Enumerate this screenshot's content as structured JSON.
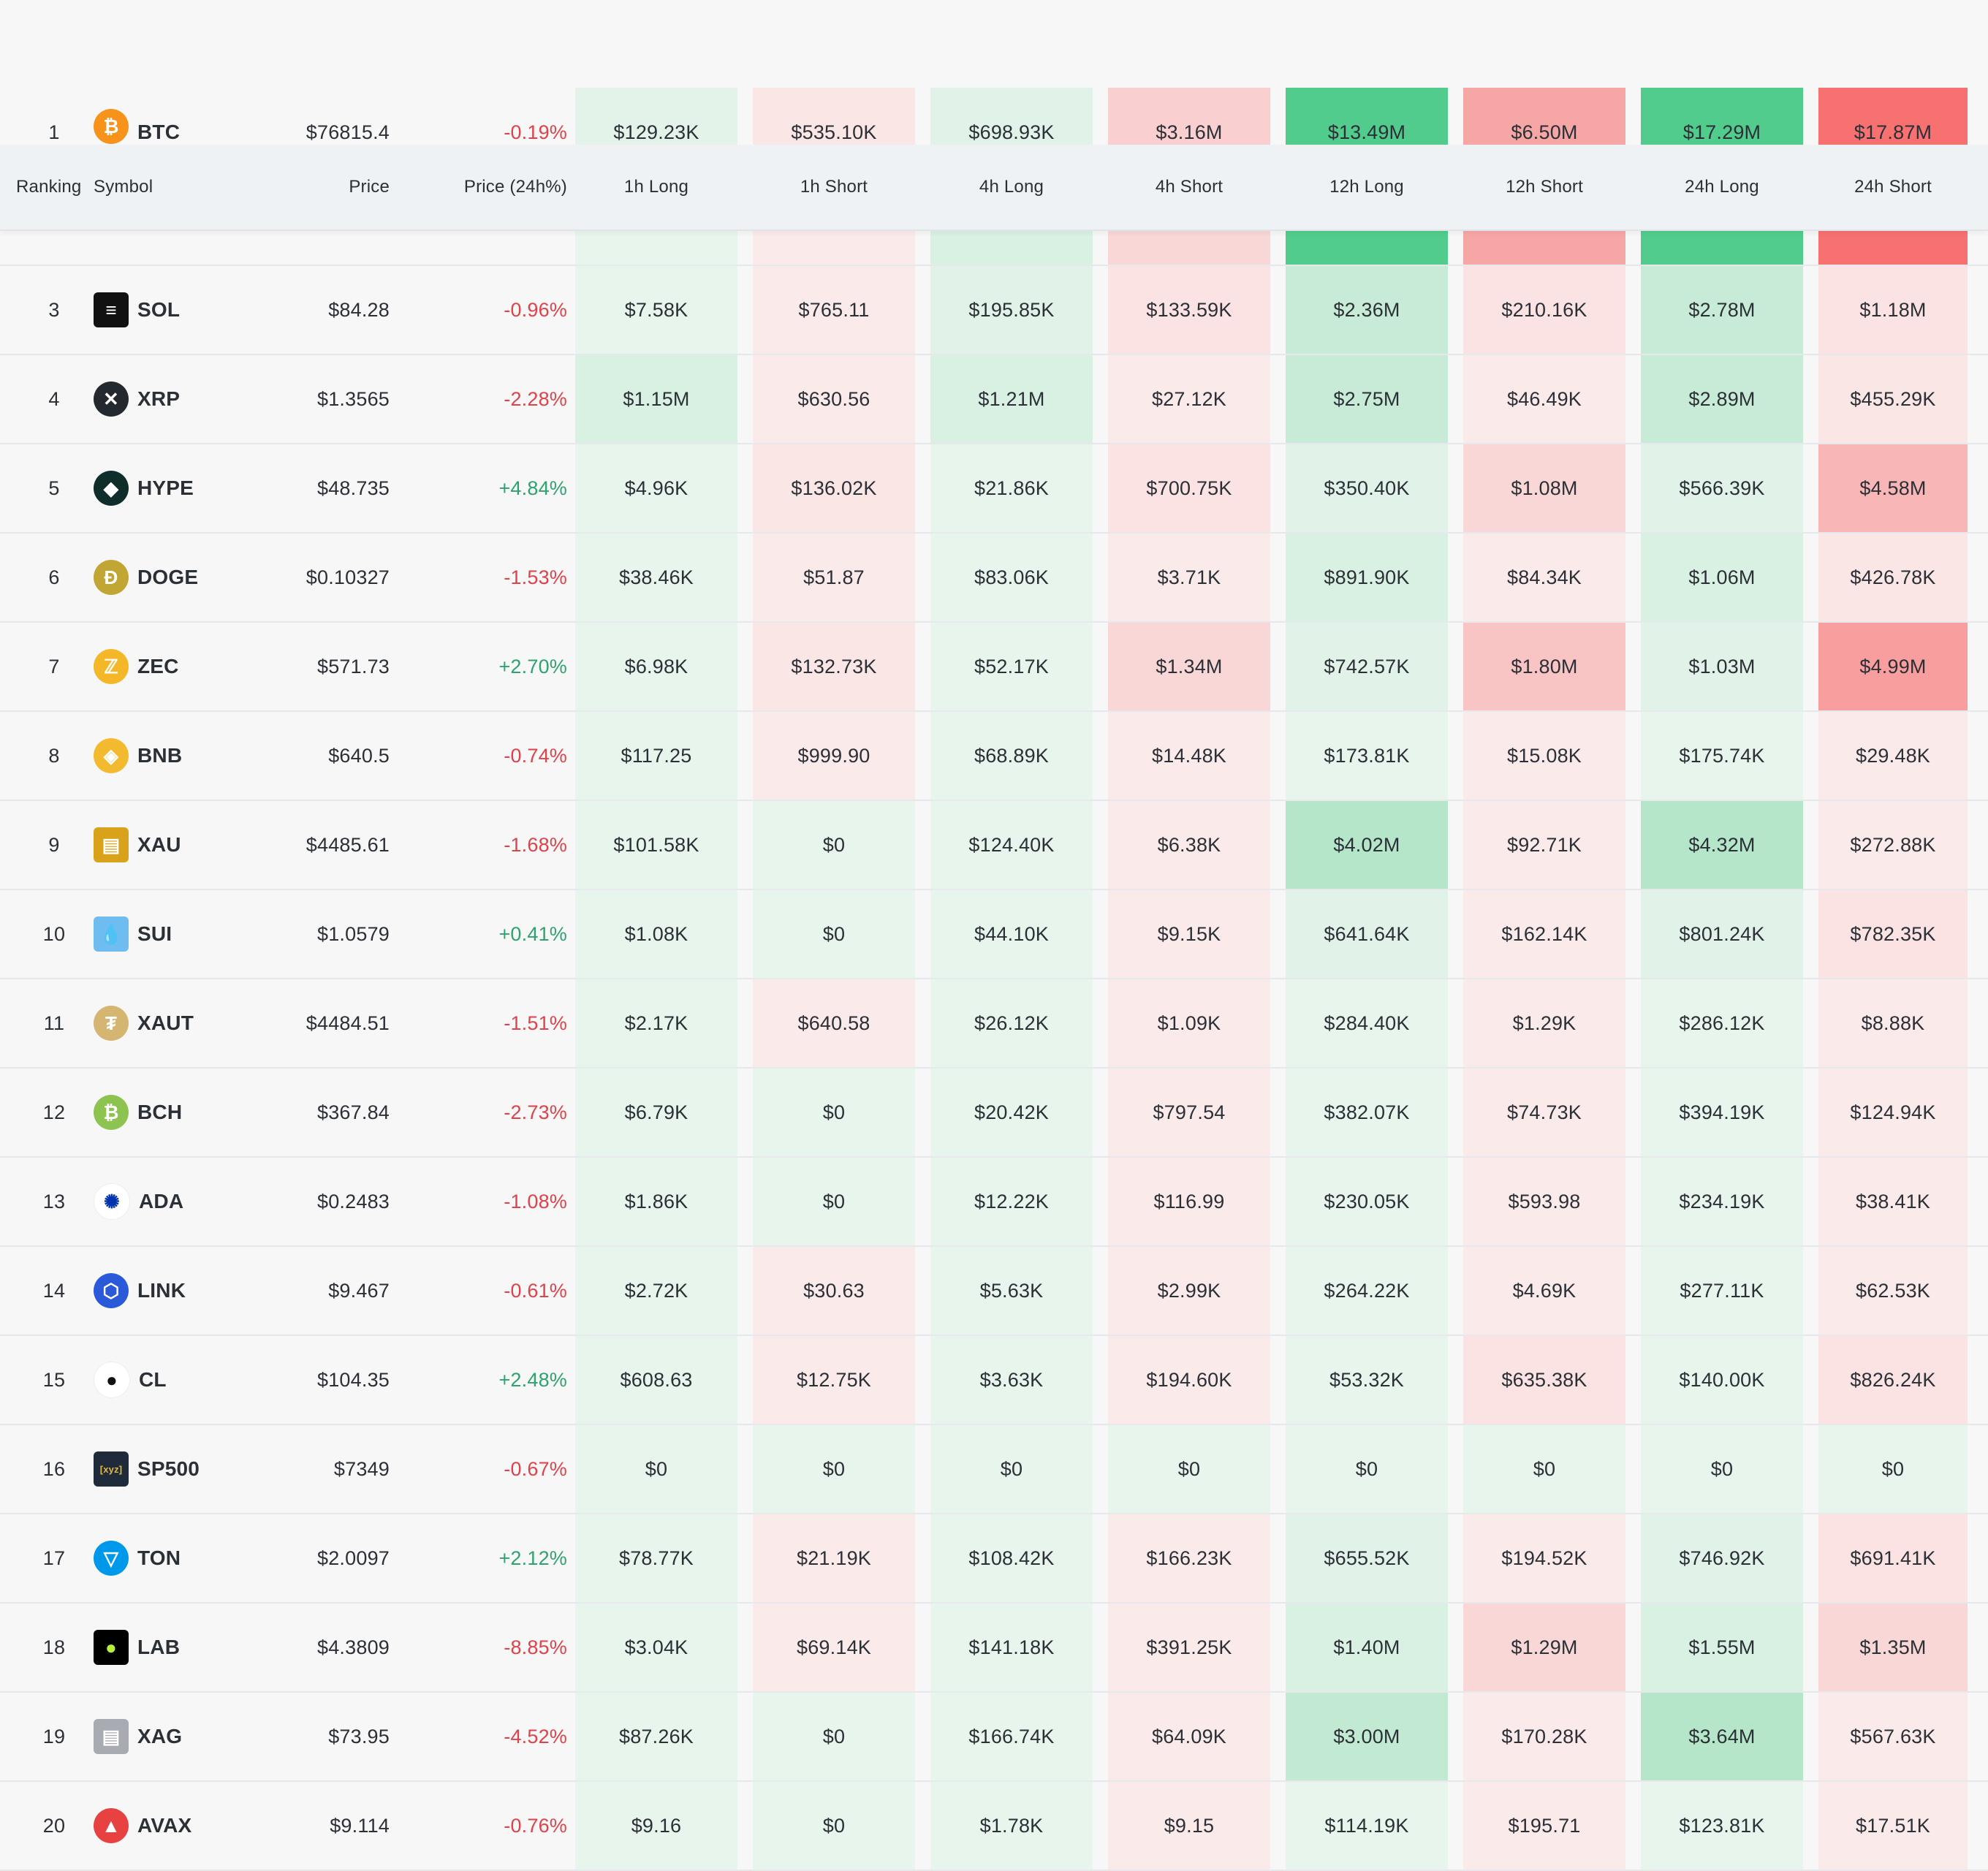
{
  "columns": {
    "ranking": "Ranking",
    "symbol": "Symbol",
    "price": "Price",
    "change": "Price (24h%)",
    "h1_long": "1h Long",
    "h1_short": "1h Short",
    "h4_long": "4h Long",
    "h4_short": "4h Short",
    "h12_long": "12h Long",
    "h12_short": "12h Short",
    "h24_long": "24h Long",
    "h24_short": "24h Short"
  },
  "rows": [
    {
      "rank": "1",
      "symbol": "BTC",
      "icon": "bitcoin-icon",
      "icon_char": "₿",
      "icon_color": "#f7931a",
      "price": "$76815.4",
      "change": "-0.19%",
      "trend": "down",
      "vals": [
        "$129.23K",
        "$535.10K",
        "$698.93K",
        "$3.16M",
        "$13.49M",
        "$6.50M",
        "$17.29M",
        "$17.87M"
      ],
      "bg": [
        "#e4f3ea",
        "#fbe6e6",
        "#e1f3e8",
        "#f9cfcf",
        "#52cc8c",
        "#f7a6a6",
        "#52cc8c",
        "#f87171"
      ]
    },
    {
      "rank": "3",
      "symbol": "SOL",
      "icon": "solana-icon",
      "icon_char": "≡",
      "icon_color": "#111111",
      "price": "$84.28",
      "change": "-0.96%",
      "trend": "down",
      "vals": [
        "$7.58K",
        "$765.11",
        "$195.85K",
        "$133.59K",
        "$2.36M",
        "$210.16K",
        "$2.78M",
        "$1.18M"
      ],
      "bg": [
        "#e8f5ec",
        "#fbeaea",
        "#e1f3e8",
        "#fbe3e3",
        "#c7ebd6",
        "#fbe3e3",
        "#c7ebd6",
        "#fbe3e3"
      ]
    },
    {
      "rank": "4",
      "symbol": "XRP",
      "icon": "xrp-icon",
      "icon_char": "✕",
      "icon_color": "#23292f",
      "price": "$1.3565",
      "change": "-2.28%",
      "trend": "down",
      "vals": [
        "$1.15M",
        "$630.56",
        "$1.21M",
        "$27.12K",
        "$2.75M",
        "$46.49K",
        "$2.89M",
        "$455.29K"
      ],
      "bg": [
        "#d9f1e2",
        "#fbeaea",
        "#d9f1e2",
        "#fbeaea",
        "#c7ebd6",
        "#fbeaea",
        "#c7ebd6",
        "#fbe6e6"
      ]
    },
    {
      "rank": "5",
      "symbol": "HYPE",
      "icon": "hyperliquid-icon",
      "icon_char": "◆",
      "icon_color": "#0f2e2b",
      "price": "$48.735",
      "change": "+4.84%",
      "trend": "up",
      "vals": [
        "$4.96K",
        "$136.02K",
        "$21.86K",
        "$700.75K",
        "$350.40K",
        "$1.08M",
        "$566.39K",
        "$4.58M"
      ],
      "bg": [
        "#e8f5ec",
        "#fbe6e6",
        "#e8f5ec",
        "#fbe3e3",
        "#e1f3e8",
        "#f9d7d7",
        "#e1f3e8",
        "#f8b6b6"
      ]
    },
    {
      "rank": "6",
      "symbol": "DOGE",
      "icon": "dogecoin-icon",
      "icon_char": "Ð",
      "icon_color": "#c2a633",
      "price": "$0.10327",
      "change": "-1.53%",
      "trend": "down",
      "vals": [
        "$38.46K",
        "$51.87",
        "$83.06K",
        "$3.71K",
        "$891.90K",
        "$84.34K",
        "$1.06M",
        "$426.78K"
      ],
      "bg": [
        "#e8f5ec",
        "#fbeaea",
        "#e8f5ec",
        "#fbeaea",
        "#d9f1e2",
        "#fbeaea",
        "#d9f1e2",
        "#fbe6e6"
      ]
    },
    {
      "rank": "7",
      "symbol": "ZEC",
      "icon": "zcash-icon",
      "icon_char": "ℤ",
      "icon_color": "#f4b728",
      "price": "$571.73",
      "change": "+2.70%",
      "trend": "up",
      "vals": [
        "$6.98K",
        "$132.73K",
        "$52.17K",
        "$1.34M",
        "$742.57K",
        "$1.80M",
        "$1.03M",
        "$4.99M"
      ],
      "bg": [
        "#e8f5ec",
        "#fbe6e6",
        "#e8f5ec",
        "#f9d7d7",
        "#e1f3e8",
        "#f8c4c4",
        "#e1f3e8",
        "#f89e9e"
      ]
    },
    {
      "rank": "8",
      "symbol": "BNB",
      "icon": "bnb-icon",
      "icon_char": "◈",
      "icon_color": "#f3ba2f",
      "price": "$640.5",
      "change": "-0.74%",
      "trend": "down",
      "vals": [
        "$117.25",
        "$999.90",
        "$68.89K",
        "$14.48K",
        "$173.81K",
        "$15.08K",
        "$175.74K",
        "$29.48K"
      ],
      "bg": [
        "#e8f5ec",
        "#fbeaea",
        "#e8f5ec",
        "#fbeaea",
        "#e8f5ec",
        "#fbeaea",
        "#e8f5ec",
        "#fbeaea"
      ]
    },
    {
      "rank": "9",
      "symbol": "XAU",
      "icon": "gold-icon",
      "icon_char": "▤",
      "icon_color": "#d9a21b",
      "price": "$4485.61",
      "change": "-1.68%",
      "trend": "down",
      "vals": [
        "$101.58K",
        "$0",
        "$124.40K",
        "$6.38K",
        "$4.02M",
        "$92.71K",
        "$4.32M",
        "$272.88K"
      ],
      "bg": [
        "#e8f5ec",
        "#e8f5ec",
        "#e8f5ec",
        "#fbeaea",
        "#b5e6ca",
        "#fbeaea",
        "#b5e6ca",
        "#fbeaea"
      ]
    },
    {
      "rank": "10",
      "symbol": "SUI",
      "icon": "sui-icon",
      "icon_char": "💧",
      "icon_color": "#6fbcf0",
      "price": "$1.0579",
      "change": "+0.41%",
      "trend": "up",
      "vals": [
        "$1.08K",
        "$0",
        "$44.10K",
        "$9.15K",
        "$641.64K",
        "$162.14K",
        "$801.24K",
        "$782.35K"
      ],
      "bg": [
        "#e8f5ec",
        "#e8f5ec",
        "#e8f5ec",
        "#fbeaea",
        "#e1f3e8",
        "#fbeaea",
        "#e1f3e8",
        "#fbe3e3"
      ]
    },
    {
      "rank": "11",
      "symbol": "XAUT",
      "icon": "tether-gold-icon",
      "icon_char": "₮",
      "icon_color": "#d4b572",
      "price": "$4484.51",
      "change": "-1.51%",
      "trend": "down",
      "vals": [
        "$2.17K",
        "$640.58",
        "$26.12K",
        "$1.09K",
        "$284.40K",
        "$1.29K",
        "$286.12K",
        "$8.88K"
      ],
      "bg": [
        "#e8f5ec",
        "#fbeaea",
        "#e8f5ec",
        "#fbeaea",
        "#e8f5ec",
        "#fbeaea",
        "#e8f5ec",
        "#fbeaea"
      ]
    },
    {
      "rank": "12",
      "symbol": "BCH",
      "icon": "bitcoin-cash-icon",
      "icon_char": "₿",
      "icon_color": "#8dc351",
      "price": "$367.84",
      "change": "-2.73%",
      "trend": "down",
      "vals": [
        "$6.79K",
        "$0",
        "$20.42K",
        "$797.54",
        "$382.07K",
        "$74.73K",
        "$394.19K",
        "$124.94K"
      ],
      "bg": [
        "#e8f5ec",
        "#e8f5ec",
        "#e8f5ec",
        "#fbeaea",
        "#e8f5ec",
        "#fbeaea",
        "#e8f5ec",
        "#fbeaea"
      ]
    },
    {
      "rank": "13",
      "symbol": "ADA",
      "icon": "cardano-icon",
      "icon_char": "✺",
      "icon_color": "#ffffff",
      "price": "$0.2483",
      "change": "-1.08%",
      "trend": "down",
      "vals": [
        "$1.86K",
        "$0",
        "$12.22K",
        "$116.99",
        "$230.05K",
        "$593.98",
        "$234.19K",
        "$38.41K"
      ],
      "bg": [
        "#e8f5ec",
        "#e8f5ec",
        "#e8f5ec",
        "#fbeaea",
        "#e8f5ec",
        "#fbeaea",
        "#e8f5ec",
        "#fbeaea"
      ]
    },
    {
      "rank": "14",
      "symbol": "LINK",
      "icon": "chainlink-icon",
      "icon_char": "⬡",
      "icon_color": "#2a5ada",
      "price": "$9.467",
      "change": "-0.61%",
      "trend": "down",
      "vals": [
        "$2.72K",
        "$30.63",
        "$5.63K",
        "$2.99K",
        "$264.22K",
        "$4.69K",
        "$277.11K",
        "$62.53K"
      ],
      "bg": [
        "#e8f5ec",
        "#fbeaea",
        "#e8f5ec",
        "#fbeaea",
        "#e8f5ec",
        "#fbeaea",
        "#e8f5ec",
        "#fbeaea"
      ]
    },
    {
      "rank": "15",
      "symbol": "CL",
      "icon": "oil-drop-icon",
      "icon_char": "●",
      "icon_color": "#ffffff",
      "price": "$104.35",
      "change": "+2.48%",
      "trend": "up",
      "vals": [
        "$608.63",
        "$12.75K",
        "$3.63K",
        "$194.60K",
        "$53.32K",
        "$635.38K",
        "$140.00K",
        "$826.24K"
      ],
      "bg": [
        "#e8f5ec",
        "#fbeaea",
        "#e8f5ec",
        "#fbeaea",
        "#e8f5ec",
        "#fbe3e3",
        "#e8f5ec",
        "#fbe3e3"
      ]
    },
    {
      "rank": "16",
      "symbol": "SP500",
      "icon": "xyz-icon",
      "icon_char": "[xyz]",
      "icon_color": "#1f2a3a",
      "price": "$7349",
      "change": "-0.67%",
      "trend": "down",
      "vals": [
        "$0",
        "$0",
        "$0",
        "$0",
        "$0",
        "$0",
        "$0",
        "$0"
      ],
      "bg": [
        "#e8f5ec",
        "#e8f5ec",
        "#e8f5ec",
        "#e8f5ec",
        "#e8f5ec",
        "#e8f5ec",
        "#e8f5ec",
        "#e8f5ec"
      ]
    },
    {
      "rank": "17",
      "symbol": "TON",
      "icon": "toncoin-icon",
      "icon_char": "▽",
      "icon_color": "#0098ea",
      "price": "$2.0097",
      "change": "+2.12%",
      "trend": "up",
      "vals": [
        "$78.77K",
        "$21.19K",
        "$108.42K",
        "$166.23K",
        "$655.52K",
        "$194.52K",
        "$746.92K",
        "$691.41K"
      ],
      "bg": [
        "#e8f5ec",
        "#fbeaea",
        "#e8f5ec",
        "#fbeaea",
        "#e1f3e8",
        "#fbeaea",
        "#e1f3e8",
        "#fbe3e3"
      ]
    },
    {
      "rank": "18",
      "symbol": "LAB",
      "icon": "lab-icon",
      "icon_char": "●",
      "icon_color": "#000000",
      "price": "$4.3809",
      "change": "-8.85%",
      "trend": "down",
      "vals": [
        "$3.04K",
        "$69.14K",
        "$141.18K",
        "$391.25K",
        "$1.40M",
        "$1.29M",
        "$1.55M",
        "$1.35M"
      ],
      "bg": [
        "#e8f5ec",
        "#fbeaea",
        "#e8f5ec",
        "#fbeaea",
        "#d9f1e2",
        "#f9d7d7",
        "#d9f1e2",
        "#f9d7d7"
      ]
    },
    {
      "rank": "19",
      "symbol": "XAG",
      "icon": "silver-icon",
      "icon_char": "▤",
      "icon_color": "#a9abb3",
      "price": "$73.95",
      "change": "-4.52%",
      "trend": "down",
      "vals": [
        "$87.26K",
        "$0",
        "$166.74K",
        "$64.09K",
        "$3.00M",
        "$170.28K",
        "$3.64M",
        "$567.63K"
      ],
      "bg": [
        "#e8f5ec",
        "#e8f5ec",
        "#e8f5ec",
        "#fbeaea",
        "#c2ead3",
        "#fbeaea",
        "#b5e6ca",
        "#fbeaea"
      ]
    },
    {
      "rank": "20",
      "symbol": "AVAX",
      "icon": "avalanche-icon",
      "icon_char": "▲",
      "icon_color": "#e84142",
      "price": "$9.114",
      "change": "-0.76%",
      "trend": "down",
      "vals": [
        "$9.16",
        "$0",
        "$1.78K",
        "$9.15",
        "$114.19K",
        "$195.71",
        "$123.81K",
        "$17.51K"
      ],
      "bg": [
        "#e8f5ec",
        "#e8f5ec",
        "#e8f5ec",
        "#fbeaea",
        "#e8f5ec",
        "#fbeaea",
        "#e8f5ec",
        "#fbeaea"
      ]
    }
  ],
  "hidden_row2_bg": [
    "#e8f5ec",
    "#fbeaea",
    "#d9f1e2",
    "#f9d7d7",
    "#52cc8c",
    "#f7a6a6",
    "#52cc8c",
    "#f87171"
  ]
}
